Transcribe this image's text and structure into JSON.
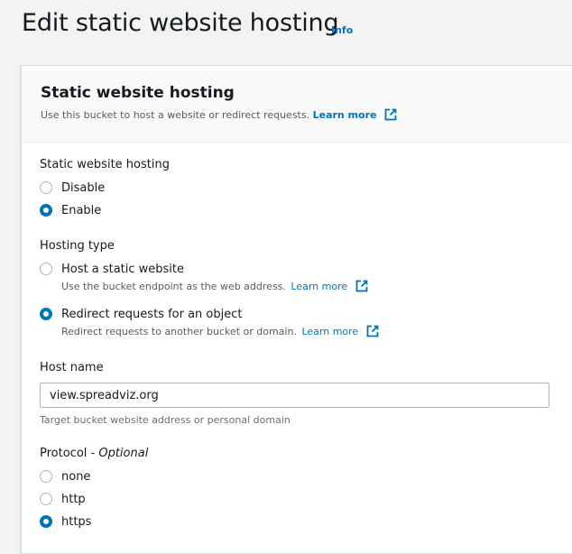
{
  "page": {
    "title": "Edit static website hosting",
    "info_label": "Info"
  },
  "panel": {
    "title": "Static website hosting",
    "description": "Use this bucket to host a website or redirect requests.",
    "learn_more": "Learn more"
  },
  "hosting": {
    "label": "Static website hosting",
    "options": [
      {
        "label": "Disable",
        "selected": false
      },
      {
        "label": "Enable",
        "selected": true
      }
    ]
  },
  "hosting_type": {
    "label": "Hosting type",
    "options": [
      {
        "label": "Host a static website",
        "description": "Use the bucket endpoint as the web address.",
        "learn_more": "Learn more",
        "selected": false
      },
      {
        "label": "Redirect requests for an object",
        "description": "Redirect requests to another bucket or domain.",
        "learn_more": "Learn more",
        "selected": true
      }
    ]
  },
  "host_name": {
    "label": "Host name",
    "value": "view.spreadviz.org",
    "constraint": "Target bucket website address or personal domain"
  },
  "protocol": {
    "label": "Protocol - ",
    "optional": "Optional",
    "options": [
      {
        "label": "none",
        "selected": false
      },
      {
        "label": "http",
        "selected": false
      },
      {
        "label": "https",
        "selected": true
      }
    ]
  },
  "colors": {
    "accent": "#0073bb",
    "background": "#f2f3f3",
    "text": "#16191f",
    "secondary_text": "#545b64"
  }
}
